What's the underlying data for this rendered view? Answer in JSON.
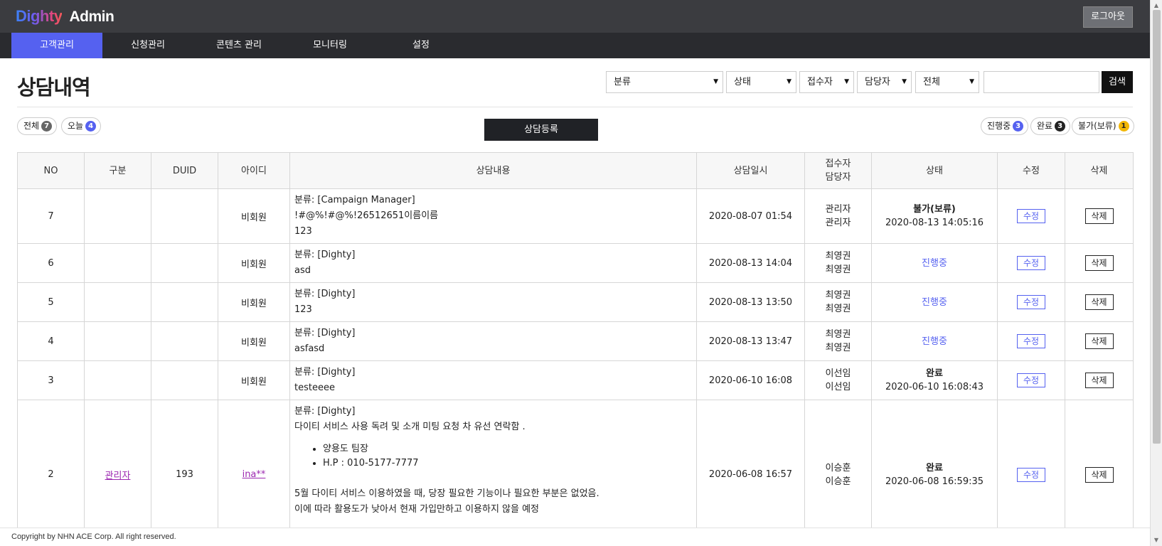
{
  "header": {
    "brand": "Dighty",
    "app": "Admin",
    "logout_label": "로그아웃"
  },
  "nav": {
    "items": [
      "고객관리",
      "신청관리",
      "콘텐츠 관리",
      "모니터링",
      "설정"
    ],
    "active_index": 0
  },
  "page": {
    "title": "상담내역"
  },
  "filters": {
    "category": "분류",
    "status": "상태",
    "receiver": "접수자",
    "manager": "담당자",
    "scope": "전체",
    "search_value": "",
    "search_label": "검색"
  },
  "counts": {
    "all_label": "전체",
    "all_count": "7",
    "today_label": "오늘",
    "today_count": "4",
    "progress_label": "진행중",
    "progress_count": "3",
    "done_label": "완료",
    "done_count": "3",
    "hold_label": "불가(보류)",
    "hold_count": "1"
  },
  "register_label": "상담등록",
  "table": {
    "headers": [
      "NO",
      "구분",
      "DUID",
      "아이디",
      "상담내용",
      "상담일시",
      "접수자",
      "담당자",
      "상태",
      "수정",
      "삭제"
    ],
    "rows": [
      {
        "no": "7",
        "type": "",
        "duid": "",
        "id": "비회원",
        "content": [
          "분류: [Campaign Manager]",
          "!#@%!#@%!26512651이름이름",
          "123"
        ],
        "date": "2020-08-07 01:54",
        "receiver": "관리자",
        "manager": "관리자",
        "status": "불가(보류)",
        "status_time": "2020-08-13 14:05:16",
        "edit": "수정",
        "delete": "삭제"
      },
      {
        "no": "6",
        "type": "",
        "duid": "",
        "id": "비회원",
        "content": [
          "분류: [Dighty]",
          "asd"
        ],
        "date": "2020-08-13 14:04",
        "receiver": "최영권",
        "manager": "최영권",
        "status": "진행중",
        "status_time": "",
        "edit": "수정",
        "delete": "삭제"
      },
      {
        "no": "5",
        "type": "",
        "duid": "",
        "id": "비회원",
        "content": [
          "분류: [Dighty]",
          "123"
        ],
        "date": "2020-08-13 13:50",
        "receiver": "최영권",
        "manager": "최영권",
        "status": "진행중",
        "status_time": "",
        "edit": "수정",
        "delete": "삭제"
      },
      {
        "no": "4",
        "type": "",
        "duid": "",
        "id": "비회원",
        "content": [
          "분류: [Dighty]",
          "asfasd"
        ],
        "date": "2020-08-13 13:47",
        "receiver": "최영권",
        "manager": "최영권",
        "status": "진행중",
        "status_time": "",
        "edit": "수정",
        "delete": "삭제"
      },
      {
        "no": "3",
        "type": "",
        "duid": "",
        "id": "비회원",
        "content": [
          "분류: [Dighty]",
          "testeeee"
        ],
        "date": "2020-06-10 16:08",
        "receiver": "이선임",
        "manager": "이선임",
        "status": "완료",
        "status_time": "2020-06-10 16:08:43",
        "edit": "수정",
        "delete": "삭제"
      },
      {
        "no": "2",
        "type": "관리자",
        "duid": "193",
        "id": "ina**",
        "content_lines_top": [
          "분류: [Dighty]",
          "다이티 서비스 사용 독려 및 소개 미팅 요청 차 유선 연락함 ."
        ],
        "content_bullets": [
          "양용도 팀장",
          "H.P : 010-5177-7777"
        ],
        "content_lines_bottom": [
          "5월 다이티 서비스 이용하였을 때, 당장 필요한 기능이나 필요한 부분은 없었음.",
          "이에 따라 활용도가 낮아서 현재 가입만하고 이용하지 않을 예정"
        ],
        "date": "2020-06-08 16:57",
        "receiver": "이승훈",
        "manager": "이승훈",
        "status": "완료",
        "status_time": "2020-06-08 16:59:35",
        "edit": "수정",
        "delete": "삭제"
      }
    ]
  },
  "footer": {
    "copyright": "Copyright by NHN ACE Corp. All right reserved."
  }
}
